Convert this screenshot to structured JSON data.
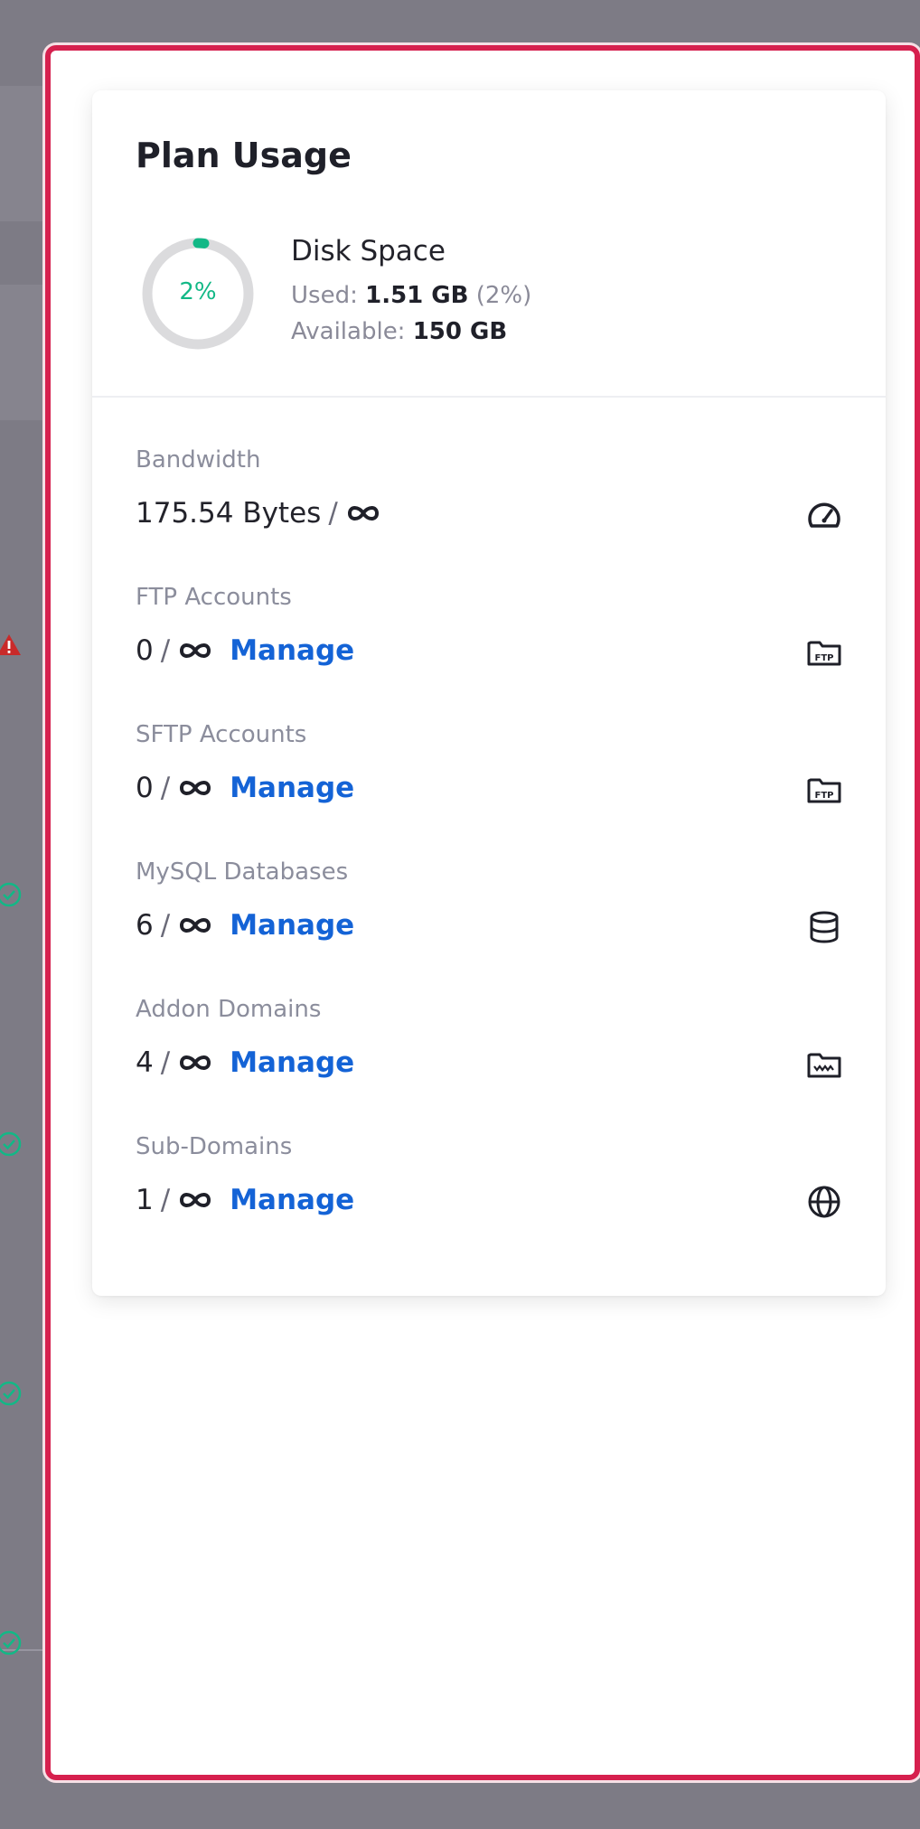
{
  "plan_usage": {
    "title": "Plan Usage",
    "disk": {
      "title": "Disk Space",
      "percent_label": "2%",
      "percent": 2,
      "used_label": "Used:",
      "used_value": "1.51 GB",
      "used_percent": "(2%)",
      "available_label": "Available:",
      "available_value": "150 GB"
    },
    "resources": [
      {
        "label": "Bandwidth",
        "value": "175.54 Bytes",
        "manage": "",
        "icon": "gauge-icon"
      },
      {
        "label": "FTP Accounts",
        "value": "0",
        "manage": "Manage",
        "icon": "ftp-folder-icon"
      },
      {
        "label": "SFTP Accounts",
        "value": "0",
        "manage": "Manage",
        "icon": "ftp-folder-icon"
      },
      {
        "label": "MySQL Databases",
        "value": "6",
        "manage": "Manage",
        "icon": "database-icon"
      },
      {
        "label": "Addon Domains",
        "value": "4",
        "manage": "Manage",
        "icon": "domain-folder-icon"
      },
      {
        "label": "Sub-Domains",
        "value": "1",
        "manage": "Manage",
        "icon": "globe-icon"
      }
    ],
    "separator": "/"
  },
  "colors": {
    "accent_blue": "#1463d6",
    "success_green": "#12b886",
    "modal_border": "#d6204e",
    "warning_red": "#c92a2a"
  }
}
